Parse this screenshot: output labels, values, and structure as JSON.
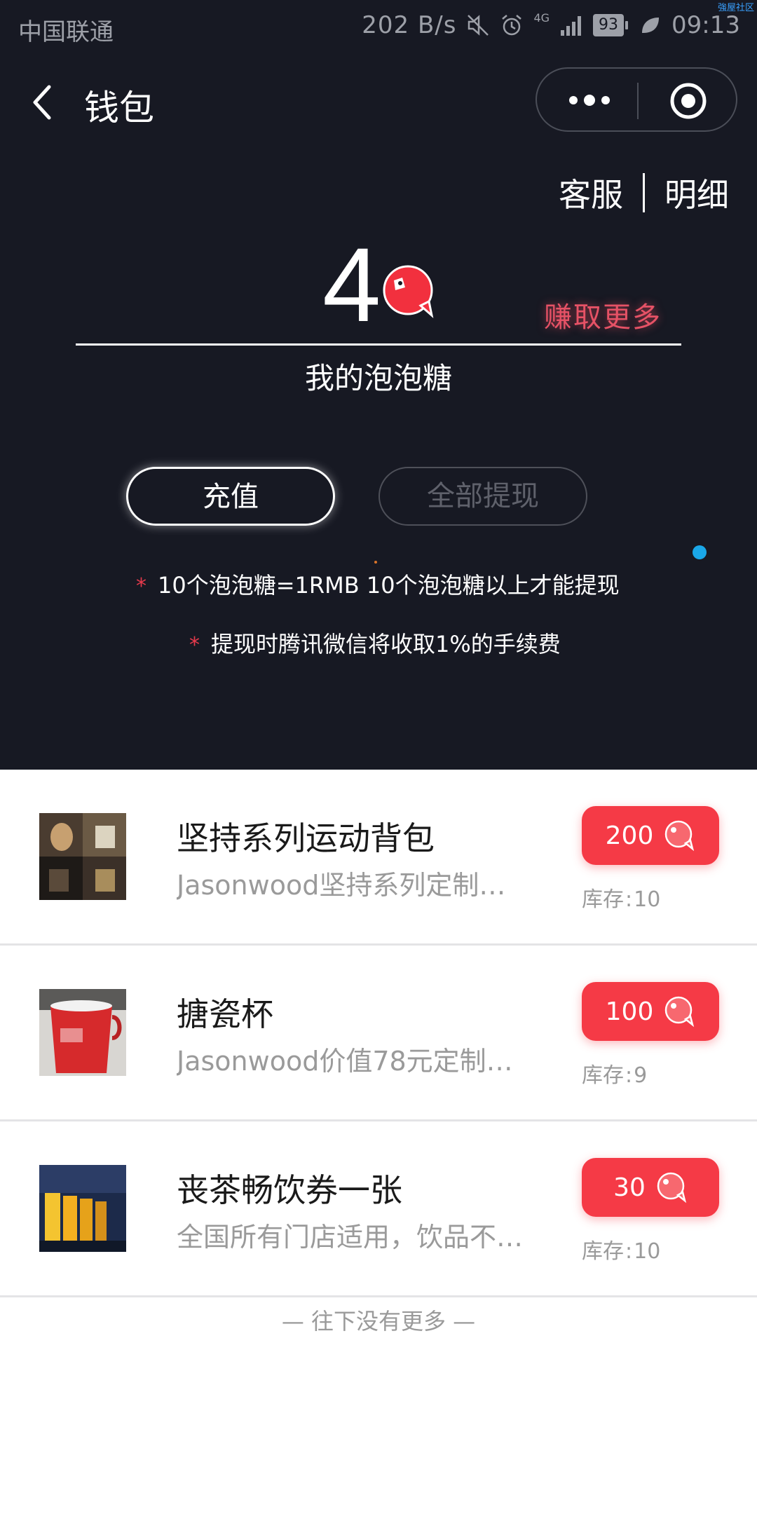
{
  "status_bar": {
    "carrier": "中国联通",
    "network_speed": "202 B/s",
    "signal": "4G",
    "battery": "93",
    "time": "09:13",
    "corner_mark": "強屋社区"
  },
  "nav": {
    "title": "钱包"
  },
  "links": {
    "service": "客服",
    "detail": "明细"
  },
  "wallet": {
    "balance": "4",
    "earn_more": "赚取更多",
    "balance_label": "我的泡泡糖",
    "recharge_label": "充值",
    "withdraw_all_label": "全部提现",
    "notes": [
      "10个泡泡糖=1RMB  10个泡泡糖以上才能提现",
      "提现时腾讯微信将收取1%的手续费"
    ],
    "note_marker": "*"
  },
  "products": [
    {
      "title": "坚持系列运动背包",
      "description": "Jasonwood坚持系列定制…",
      "price": "200",
      "stock_label": "库存",
      "stock": "10"
    },
    {
      "title": "搪瓷杯",
      "description": "Jasonwood价值78元定制…",
      "price": "100",
      "stock_label": "库存",
      "stock": "9"
    },
    {
      "title": "丧茶畅饮券一张",
      "description": "全国所有门店适用，饮品不…",
      "price": "30",
      "stock_label": "库存",
      "stock": "10"
    }
  ],
  "footer": {
    "end_text": "— 往下没有更多 —"
  },
  "colors": {
    "accent": "#f53a46",
    "dark_bg": "#171923",
    "earn": "#e65266"
  }
}
